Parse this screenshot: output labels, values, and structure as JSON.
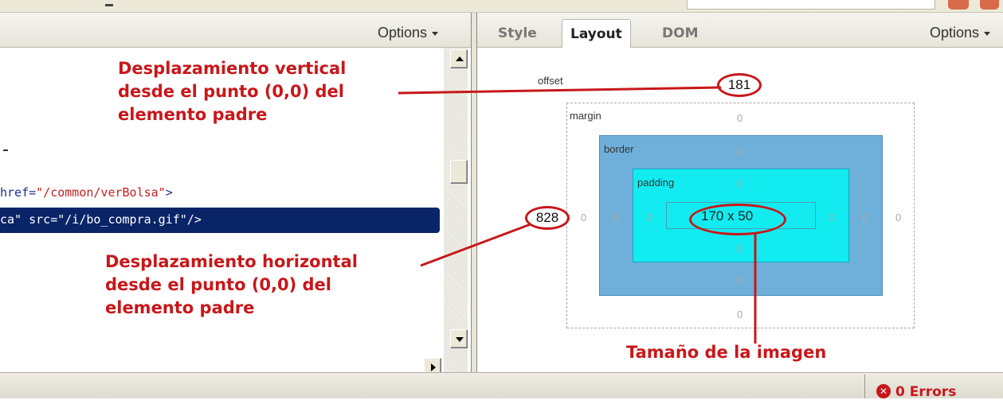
{
  "left_panel": {
    "options_label": "Options",
    "code_line1_attr": "href=",
    "code_line1_value": "\"/common/verBolsa\"",
    "code_line1_end": ">",
    "code_line2": "ca\" src=\"/i/bo_compra.gif\"/>"
  },
  "right_panel": {
    "tabs": [
      "Style",
      "Layout",
      "DOM"
    ],
    "active_tab": "Layout",
    "options_label": "Options"
  },
  "box_model": {
    "offset_label": "offset",
    "offset_top": "181",
    "offset_left": "828",
    "margin_label": "margin",
    "border_label": "border",
    "padding_label": "padding",
    "zero": "0",
    "content_size": "170 x 50",
    "colors": {
      "border_fill": "#6eb0da",
      "padding_fill": "#12ecf0",
      "annotation": "#c8171a"
    }
  },
  "annotations": {
    "vertical": [
      "Desplazamiento vertical",
      "desde el punto (0,0) del",
      "elemento padre"
    ],
    "horizontal": [
      "Desplazamiento horizontal",
      "desde el punto (0,0) del",
      "elemento padre"
    ],
    "size": "Tamaño de la imagen"
  },
  "status": {
    "errors_label": "0 Errors",
    "error_icon": "x-circle-icon"
  }
}
